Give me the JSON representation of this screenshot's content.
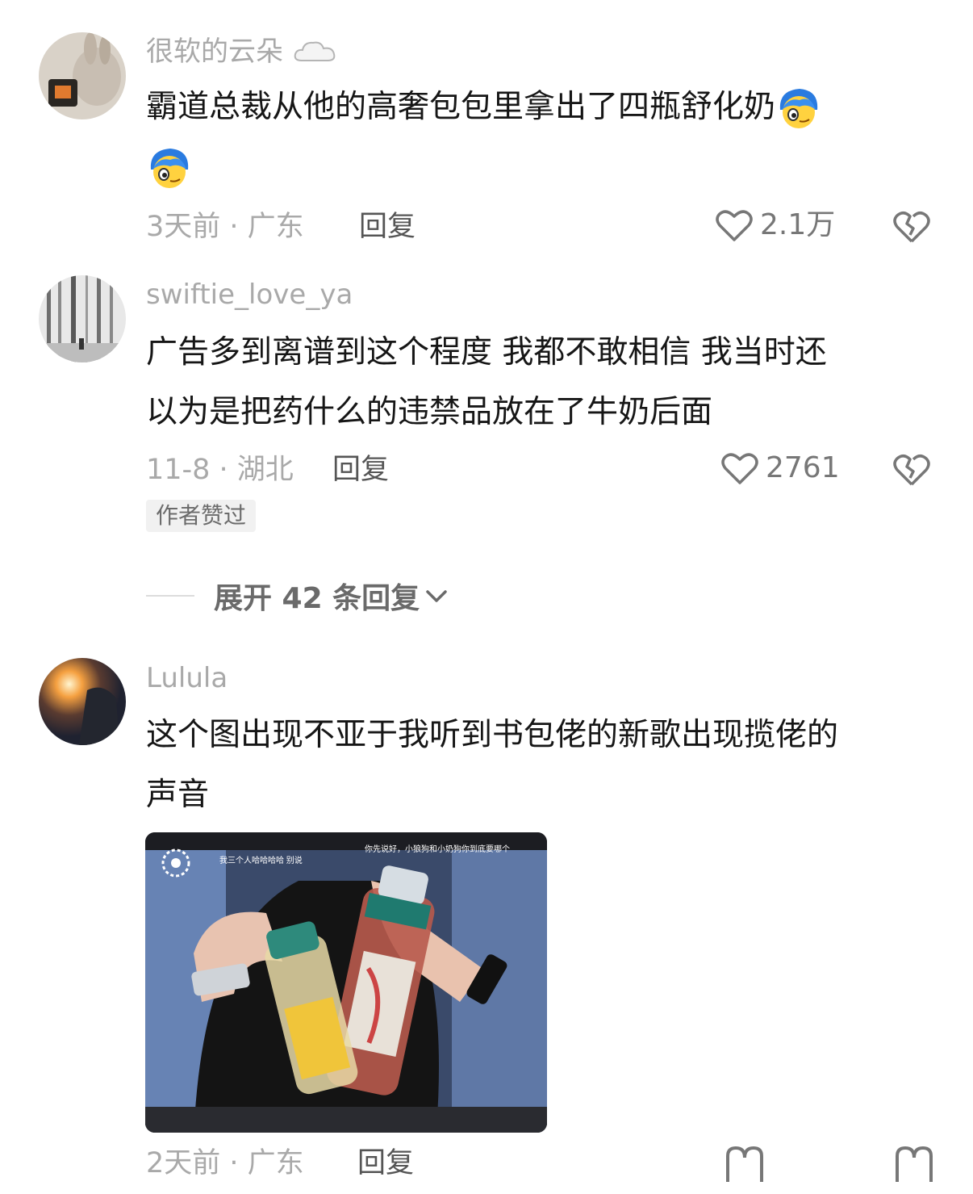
{
  "comments": [
    {
      "username": "很软的云朵",
      "username_icon": "cloud-icon",
      "text": "霸道总裁从他的高奢包包里拿出了四瓶舒化奶",
      "emoji": "blue-hair-emoji",
      "time_location": "3天前 · 广东",
      "reply_label": "回复",
      "likes": "2.1万"
    },
    {
      "username": "swiftie_love_ya",
      "text_line1": "广告多到离谱到这个程度 我都不敢相信 我当时还",
      "text_line2": "以为是把药什么的违禁品放在了牛奶后面",
      "time_location": "11-8 · 湖北",
      "reply_label": "回复",
      "likes": "2761",
      "author_tag": "作者赞过",
      "expand_label": "展开 42 条回复"
    },
    {
      "username": "Lulula",
      "text_line1": "这个图出现不亚于我听到书包佬的新歌出现揽佬的",
      "text_line2": "声音",
      "time_location": "2天前 · 广东",
      "reply_label": "回复",
      "image_caption_1": "我三个人哈哈哈哈 别说",
      "image_caption_2": "你先说好，小狼狗和小奶狗你到底要哪个"
    }
  ],
  "colors": {
    "username": "#a9a9a9",
    "text": "#161616",
    "meta": "#a9a9a9",
    "icon": "#777777"
  }
}
